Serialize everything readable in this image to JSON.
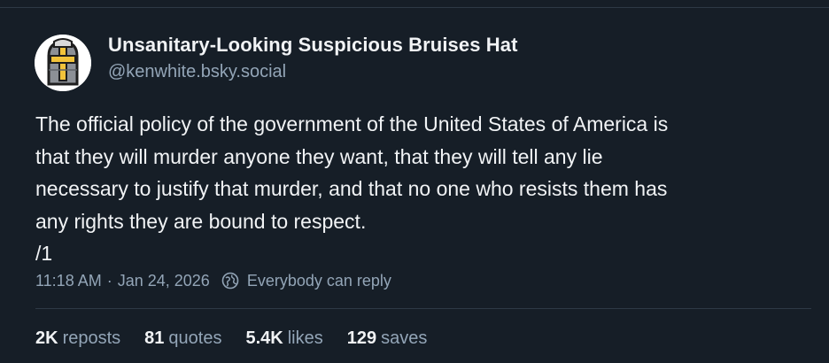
{
  "post": {
    "author": {
      "display_name": "Unsanitary-Looking Suspicious Bruises Hat",
      "handle": "@kenwhite.bsky.social",
      "avatar_icon": "helmet-cross-icon"
    },
    "text_lines": [
      "The official policy of the government of the United States of America is",
      "that they will murder anyone they want, that they will tell any lie",
      "necessary to justify that murder, and that no one who resists them has",
      "any rights they are bound to respect.",
      "/1"
    ],
    "time": "11:18 AM",
    "separator": "·",
    "date": "Jan 24, 2026",
    "reply_setting": {
      "icon": "globe-icon",
      "label": "Everybody can reply"
    },
    "stats": {
      "reposts": {
        "count": "2K",
        "label": "reposts"
      },
      "quotes": {
        "count": "81",
        "label": "quotes"
      },
      "likes": {
        "count": "5.4K",
        "label": "likes"
      },
      "saves": {
        "count": "129",
        "label": "saves"
      }
    }
  },
  "colors": {
    "background": "#161e27",
    "text_primary": "#f1f3f5",
    "text_secondary": "#93a5b7",
    "divider": "#2e3945",
    "avatar_gold": "#f2c33a",
    "avatar_gray": "#8c9096"
  }
}
